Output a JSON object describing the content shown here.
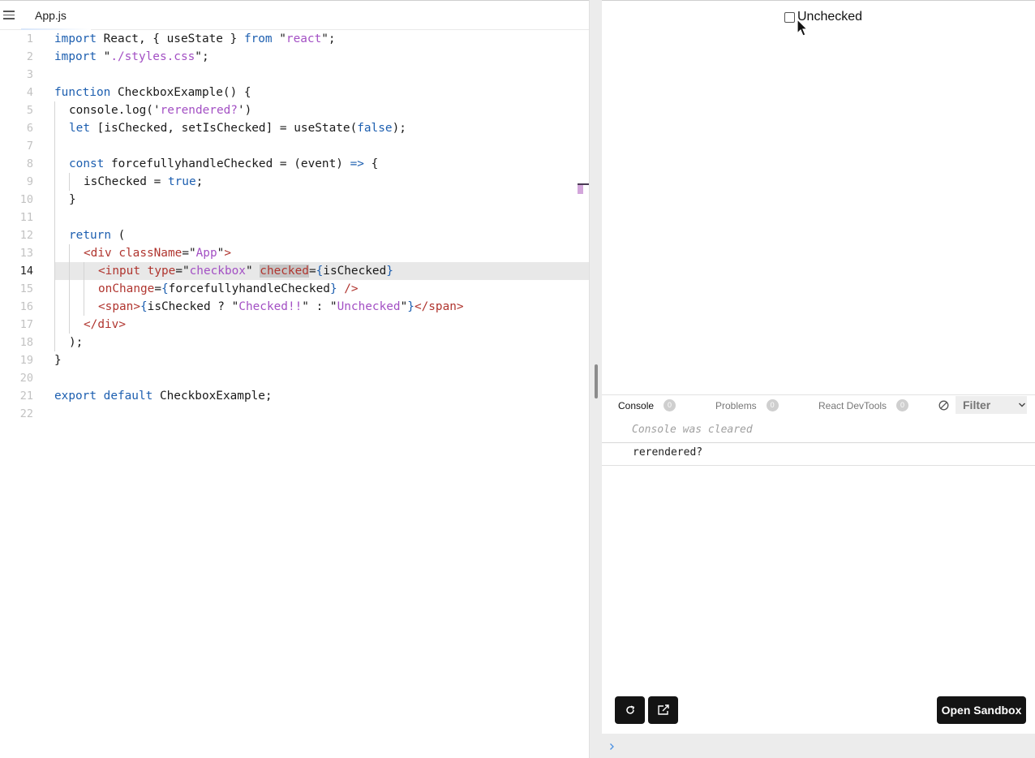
{
  "editor": {
    "tab_label": "App.js",
    "lines": [
      {
        "n": "1"
      },
      {
        "n": "2"
      },
      {
        "n": "3"
      },
      {
        "n": "4"
      },
      {
        "n": "5"
      },
      {
        "n": "6"
      },
      {
        "n": "7"
      },
      {
        "n": "8"
      },
      {
        "n": "9"
      },
      {
        "n": "10"
      },
      {
        "n": "11"
      },
      {
        "n": "12"
      },
      {
        "n": "13"
      },
      {
        "n": "14"
      },
      {
        "n": "15"
      },
      {
        "n": "16"
      },
      {
        "n": "17"
      },
      {
        "n": "18"
      },
      {
        "n": "19"
      },
      {
        "n": "20"
      },
      {
        "n": "21"
      },
      {
        "n": "22"
      }
    ],
    "code": {
      "l1": [
        "import",
        " React, { useState } ",
        "from",
        " \"",
        "react",
        "\";"
      ],
      "l2": [
        "import",
        " \"",
        "./styles.css",
        "\";"
      ],
      "l4": [
        "function",
        " CheckboxExample() {"
      ],
      "l5": [
        "console.log('",
        "rerendered?",
        "')"
      ],
      "l6": [
        "let",
        " [isChecked, setIsChecked] = useState(",
        "false",
        ");"
      ],
      "l8": [
        "const",
        " forcefullyhandleChecked = (event) ",
        "=>",
        " {"
      ],
      "l9": [
        "isChecked = ",
        "true",
        ";"
      ],
      "l10": [
        "}"
      ],
      "l12": [
        "return",
        " ("
      ],
      "l13": [
        "<div",
        " ",
        "className",
        "=\"",
        "App",
        "\"",
        ">"
      ],
      "l14": [
        "<input",
        " ",
        "type",
        "=\"",
        "checkbox",
        "\" ",
        "checked",
        "=",
        "{",
        "isChecked",
        "}"
      ],
      "l15": [
        "onChange",
        "=",
        "{",
        "forcefullyhandleChecked",
        "}",
        " />"
      ],
      "l16": [
        "<span>",
        "{",
        "isChecked ? \"",
        "Checked!!",
        "\" : \"",
        "Unchecked",
        "\"",
        "}",
        "</span>"
      ],
      "l17": [
        "</div>"
      ],
      "l18": [
        ");"
      ],
      "l19": [
        "}"
      ],
      "l21": [
        "export",
        " ",
        "default",
        " CheckboxExample;"
      ]
    }
  },
  "preview": {
    "checkbox_label": "Unchecked",
    "checkbox_checked": false
  },
  "devtools": {
    "tabs": [
      {
        "label": "Console",
        "count": "0"
      },
      {
        "label": "Problems",
        "count": "0"
      },
      {
        "label": "React DevTools",
        "count": "0"
      }
    ],
    "filter_placeholder": "Filter",
    "console_cleared_text": "Console was cleared",
    "log_entries": [
      "rerendered?"
    ],
    "open_sandbox_label": "Open Sandbox"
  },
  "icons": {
    "menu": "hamburger-icon",
    "refresh": "refresh-icon",
    "open_new_window": "external-link-icon",
    "clear_console": "clear-console-icon",
    "filter_dropdown": "chevron-down-icon",
    "prompt": "chevron-right-icon",
    "cursor": "mouse-pointer-icon"
  },
  "colors": {
    "keyword": "#1d5fb0",
    "string": "#a350c4",
    "tag": "#b0352f",
    "button_bg": "#141414"
  }
}
